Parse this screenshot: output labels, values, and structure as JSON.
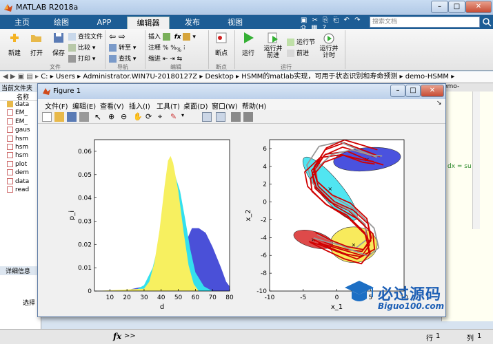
{
  "app": {
    "title": "MATLAB R2018a",
    "search_placeholder": "搜索文档"
  },
  "tabs": [
    {
      "label": "主页"
    },
    {
      "label": "绘图"
    },
    {
      "label": "APP"
    },
    {
      "label": "编辑器"
    },
    {
      "label": "发布"
    },
    {
      "label": "视图"
    }
  ],
  "ribbon": {
    "new": "新建",
    "open": "打开",
    "save": "保存",
    "find_files": "查找文件",
    "compare": "比较",
    "print": "打印",
    "insert": "插入",
    "comment": "注释",
    "indent": "缩进",
    "goto": "转至",
    "find": "查找",
    "breakpoints": "断点",
    "run": "运行",
    "run_advance": "运行并\n前进",
    "run_section": "运行节",
    "advance": "前进",
    "run_time": "运行并\n计时",
    "groups": {
      "file": "文件",
      "navigate": "导航",
      "edit": "编辑",
      "breakpoints": "断点",
      "run": "运行"
    }
  },
  "address": {
    "parts": [
      "C:",
      "Users",
      "Administrator.WIN7U-20180127Z",
      "Desktop",
      "HSMM的matlab实现，可用于状态识别和寿命预测",
      "demo-HSMM"
    ]
  },
  "current_folder": {
    "title": "当前文件夹",
    "column": "名称",
    "files": [
      "data",
      "EM_",
      "EM_",
      "gaus",
      "hsm",
      "hsm",
      "hsm",
      "plot",
      "dem",
      "data",
      "read"
    ]
  },
  "details": {
    "title": "详细信息",
    "hint": "选择"
  },
  "editor_snippet": {
    "tab": "emo-",
    "code": "dx = su"
  },
  "status": {
    "prompt": ">>",
    "row_label": "行",
    "row_value": "1",
    "col_label": "列",
    "col_value": "1"
  },
  "figure": {
    "title": "Figure 1",
    "menu": [
      "文件(F)",
      "编辑(E)",
      "查看(V)",
      "插入(I)",
      "工具(T)",
      "桌面(D)",
      "窗口(W)",
      "帮助(H)"
    ]
  },
  "watermark": {
    "line1": "必过源码",
    "line2": "Biguo100.com"
  },
  "chart_data": [
    {
      "type": "area",
      "xlabel": "d",
      "ylabel": "p_i",
      "xlim": [
        1,
        80
      ],
      "ylim": [
        0,
        0.065
      ],
      "xticks": [
        10,
        20,
        30,
        40,
        50,
        60,
        70,
        80
      ],
      "yticks": [
        0,
        0.01,
        0.02,
        0.03,
        0.04,
        0.05,
        0.06
      ],
      "series": [
        {
          "color": "#4a50d8",
          "points": [
            [
              1,
              0
            ],
            [
              20,
              0.0004
            ],
            [
              30,
              0.002
            ],
            [
              35,
              0.005
            ],
            [
              40,
              0.009
            ],
            [
              45,
              0.012
            ],
            [
              50,
              0.014
            ],
            [
              55,
              0.022
            ],
            [
              58,
              0.027
            ],
            [
              62,
              0.027
            ],
            [
              66,
              0.025
            ],
            [
              70,
              0.019
            ],
            [
              75,
              0.01
            ],
            [
              78,
              0.004
            ],
            [
              80,
              0.002
            ]
          ]
        },
        {
          "color": "#33e0ee",
          "points": [
            [
              1,
              0
            ],
            [
              25,
              0.0004
            ],
            [
              30,
              0.0025
            ],
            [
              35,
              0.01
            ],
            [
              39,
              0.022
            ],
            [
              42,
              0.036
            ],
            [
              45,
              0.048
            ],
            [
              48,
              0.05
            ],
            [
              51,
              0.043
            ],
            [
              54,
              0.031
            ],
            [
              57,
              0.018
            ],
            [
              60,
              0.008
            ],
            [
              65,
              0.002
            ],
            [
              70,
              0
            ]
          ]
        },
        {
          "color": "#f7f060",
          "points": [
            [
              1,
              0
            ],
            [
              30,
              0.001
            ],
            [
              33,
              0.004
            ],
            [
              36,
              0.012
            ],
            [
              39,
              0.026
            ],
            [
              42,
              0.045
            ],
            [
              44,
              0.056
            ],
            [
              45.5,
              0.058
            ],
            [
              47,
              0.055
            ],
            [
              50,
              0.043
            ],
            [
              53,
              0.026
            ],
            [
              56,
              0.011
            ],
            [
              59,
              0.003
            ],
            [
              62,
              0
            ]
          ]
        }
      ]
    },
    {
      "type": "scatter",
      "xlabel": "x_1",
      "ylabel": "x_2",
      "xlim": [
        -10,
        10
      ],
      "ylim": [
        -10,
        7
      ],
      "xticks": [
        -10,
        -5,
        0,
        5,
        10
      ],
      "yticks": [
        -10,
        -8,
        -6,
        -4,
        -2,
        0,
        2,
        4,
        6
      ],
      "ellipses": [
        {
          "color": "#2a34d8",
          "center": [
            4.5,
            4.8
          ],
          "radii": [
            5,
            1.3
          ],
          "angle": 5
        },
        {
          "color": "#33e0ee",
          "center": [
            -1,
            1.5
          ],
          "radii": [
            6,
            1.2
          ],
          "angle": -50
        },
        {
          "color": "#f7e640",
          "center": [
            2.5,
            -4.8
          ],
          "radii": [
            3.5,
            2
          ],
          "angle": 0
        },
        {
          "color": "#d82a2a",
          "center": [
            -3.5,
            -4.2
          ],
          "radii": [
            3,
            0.9
          ],
          "angle": -15
        }
      ],
      "trajectory_colors": [
        "#d00000",
        "#999999"
      ]
    }
  ]
}
